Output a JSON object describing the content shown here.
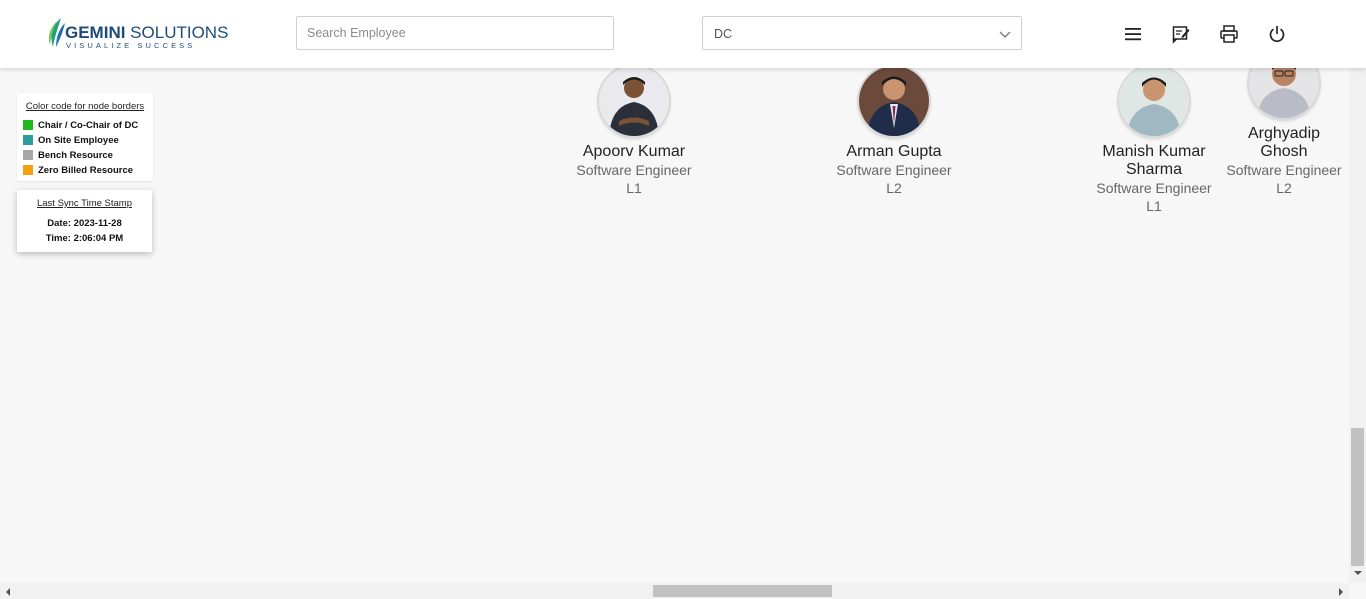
{
  "header": {
    "logo": {
      "name": "GEMINI SOLUTIONS",
      "brand_bold": "GEMINI",
      "brand_rest": " SOLUTIONS",
      "tagline": "VISUALIZE SUCCESS"
    },
    "search": {
      "placeholder": "Search Employee",
      "value": ""
    },
    "dropdown": {
      "selected": "DC"
    },
    "icons": [
      "menu-icon",
      "edit-note-icon",
      "print-icon",
      "power-icon"
    ]
  },
  "legend": {
    "title": "Color code for node borders",
    "items": [
      {
        "label": "Chair / Co-Chair of DC",
        "color": "#1fb81f"
      },
      {
        "label": "On Site Employee",
        "color": "#2a9d9d"
      },
      {
        "label": "Bench Resource",
        "color": "#a6a6a6"
      },
      {
        "label": "Zero Billed Resource",
        "color": "#f5a00c"
      }
    ]
  },
  "sync": {
    "title": "Last Sync Time Stamp",
    "date": "Date: 2023-11-28",
    "time": "Time: 2:06:04 PM"
  },
  "employees": [
    {
      "name": "Apoorv Kumar",
      "title": "Software Engineer",
      "level": "L1"
    },
    {
      "name": "Arman Gupta",
      "title": "Software Engineer",
      "level": "L2"
    },
    {
      "name_line1": "Manish Kumar",
      "name_line2": "Sharma",
      "title": "Software Engineer",
      "level": "L1"
    },
    {
      "name_line1": "Arghyadip",
      "name_line2": "Ghosh",
      "title": "Software Engineer",
      "level": "L2"
    }
  ],
  "colors": {
    "brand": "#1e4c7a",
    "leaf": "#1fa37a",
    "background": "#f7f7f7"
  }
}
